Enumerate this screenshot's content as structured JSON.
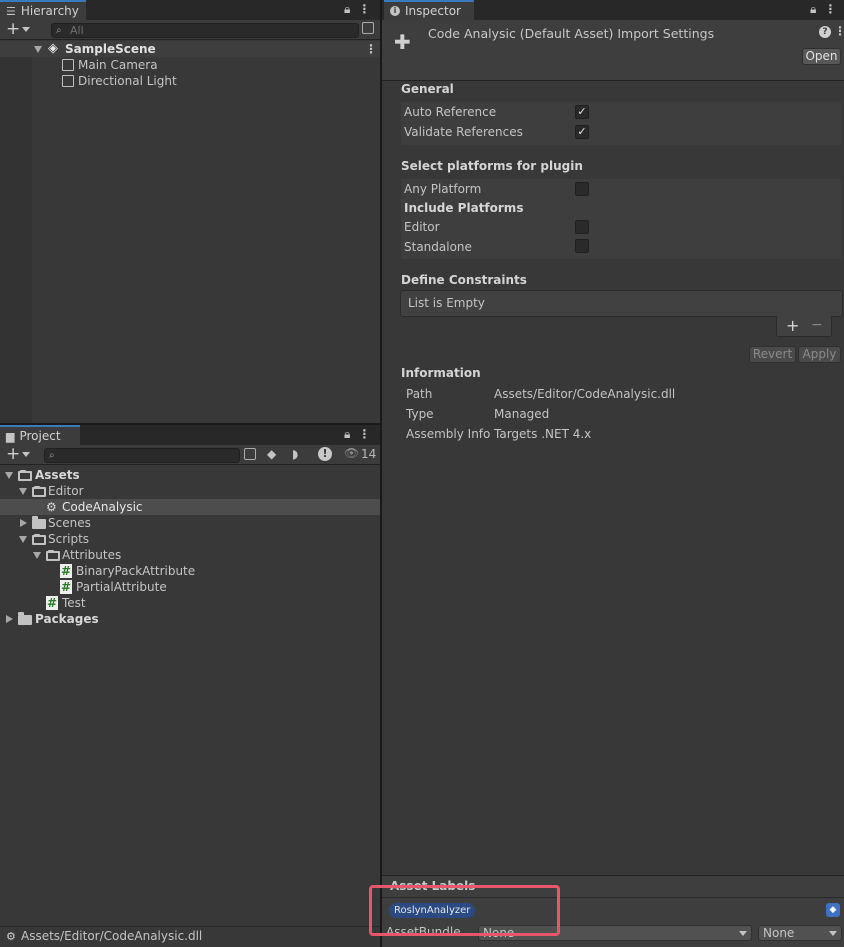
{
  "hierarchy": {
    "tab_label": "Hierarchy",
    "search_placeholder": "All",
    "scene_name": "SampleScene",
    "objects": [
      "Main Camera",
      "Directional Light"
    ]
  },
  "project": {
    "tab_label": "Project",
    "hidden_count": "14",
    "tree": {
      "assets": "Assets",
      "editor": "Editor",
      "code_analysic": "CodeAnalysic",
      "scenes": "Scenes",
      "scripts": "Scripts",
      "attributes": "Attributes",
      "binary_pack": "BinaryPackAttribute",
      "partial": "PartialAttribute",
      "test": "Test",
      "packages": "Packages"
    },
    "status_path": "Assets/Editor/CodeAnalysic.dll"
  },
  "inspector": {
    "tab_label": "Inspector",
    "title": "Code Analysic (Default Asset) Import Settings",
    "open_label": "Open",
    "general": {
      "title": "General",
      "auto_reference": "Auto Reference",
      "validate_references": "Validate References",
      "check_mark": "✓"
    },
    "platforms": {
      "title": "Select platforms for plugin",
      "any_platform": "Any Platform",
      "include_title": "Include Platforms",
      "editor": "Editor",
      "standalone": "Standalone"
    },
    "constraints": {
      "title": "Define Constraints",
      "empty_text": "List is Empty",
      "add": "+",
      "remove": "−"
    },
    "revert_label": "Revert",
    "apply_label": "Apply",
    "information": {
      "title": "Information",
      "path_label": "Path",
      "path_value": "Assets/Editor/CodeAnalysic.dll",
      "type_label": "Type",
      "type_value": "Managed",
      "assembly_label": "Assembly Info",
      "assembly_value": "Targets .NET 4.x"
    },
    "asset_labels": {
      "title": "Asset Labels",
      "label": "RoslynAnalyzer",
      "bundle_label": "AssetBundle",
      "bundle_value": "None",
      "variant_value": "None"
    }
  },
  "colors": {
    "highlight_box": "#e8566a",
    "label_chip": "#2b4a82",
    "selection": "#4d4d4d",
    "accent": "#3a79bb"
  },
  "icons": {
    "lock": "🔒",
    "menu": "⋮",
    "help": "?",
    "tag": "tag-icon",
    "eye": "👁"
  }
}
